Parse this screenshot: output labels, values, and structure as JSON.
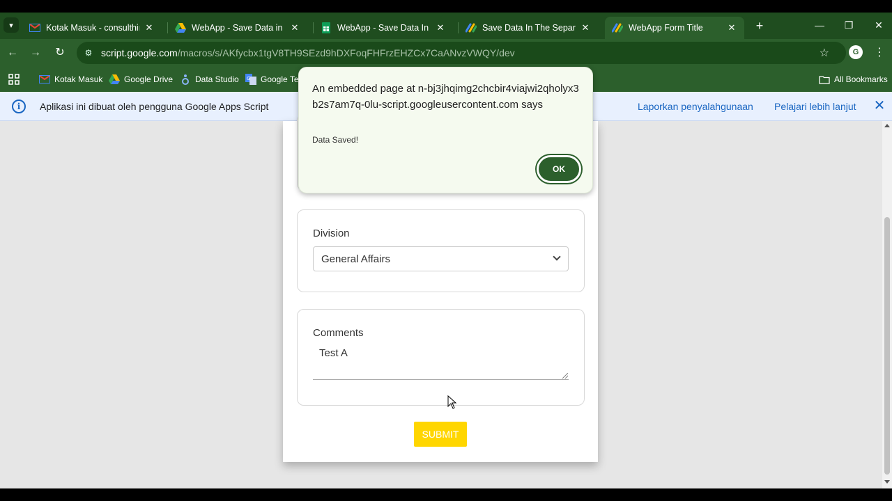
{
  "tabs": [
    {
      "title": "Kotak Masuk - consulthinkpro",
      "icon": "gmail-icon"
    },
    {
      "title": "WebApp - Save Data in Separate",
      "icon": "google-drive-icon"
    },
    {
      "title": "WebApp - Save Data In The",
      "icon": "google-sheets-icon"
    },
    {
      "title": "Save Data In The Separate Sheet",
      "icon": "apps-script-icon"
    },
    {
      "title": "WebApp Form Title",
      "icon": "apps-script-icon",
      "active": true
    }
  ],
  "address_bar": {
    "host": "script.google.com",
    "path": "/macros/s/AKfycbx1tgV8TH9SEzd9hDXFoqFHFrzEHZCx7CaANvzVWQY/dev"
  },
  "bookmarks": [
    {
      "label": "Kotak Masuk",
      "icon": "gmail-icon"
    },
    {
      "label": "Google Drive",
      "icon": "google-drive-icon"
    },
    {
      "label": "Data Studio",
      "icon": "data-studio-icon"
    },
    {
      "label": "Google Ter",
      "icon": "google-translate-icon"
    }
  ],
  "all_bookmarks_label": "All Bookmarks",
  "infobar": {
    "message": "Aplikasi ini dibuat oleh pengguna Google Apps Script",
    "report_link": "Laporkan penyalahgunaan",
    "learn_link": "Pelajari lebih lanjut"
  },
  "form": {
    "division": {
      "label": "Division",
      "selected": "General Affairs"
    },
    "comments": {
      "label": "Comments",
      "value": "Test A"
    },
    "submit_label": "SUBMIT"
  },
  "dialog": {
    "heading": "An embedded page at n-bj3jhqimg2chcbir4viajwi2qholyx3b2s7am7q-0lu-script.googleusercontent.com says",
    "message": "Data Saved!",
    "ok_label": "OK"
  },
  "colors": {
    "chrome_dark": "#1f4d1f",
    "chrome": "#2c5f2c",
    "submit": "#ffd600",
    "link": "#1a66c2"
  }
}
